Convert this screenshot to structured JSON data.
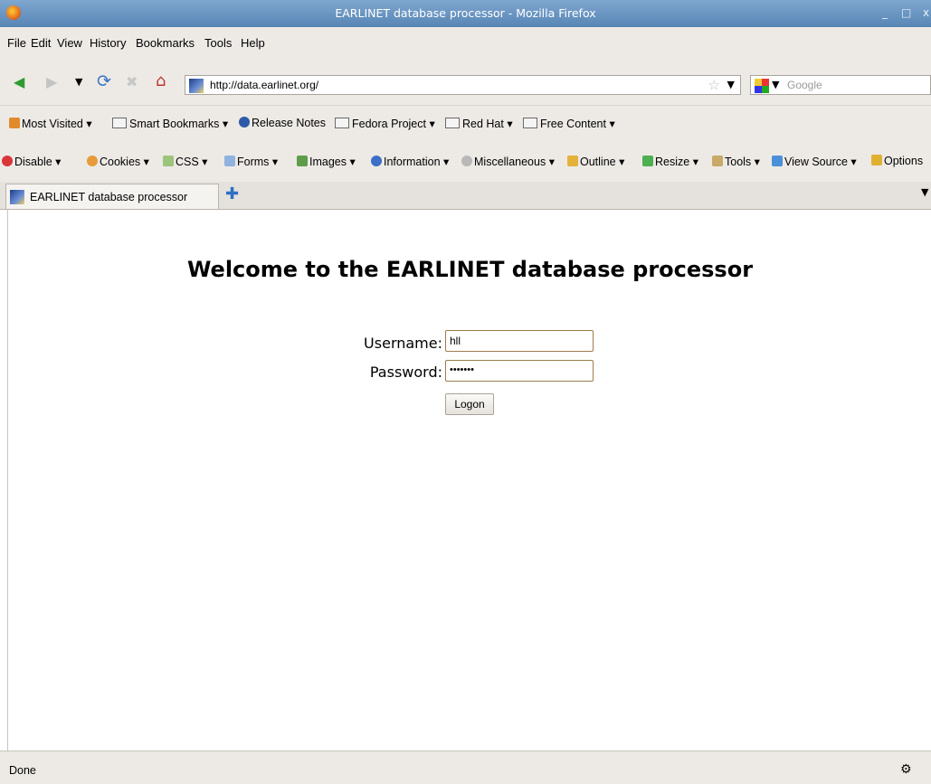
{
  "window": {
    "title": "EARLINET database processor - Mozilla Firefox",
    "minimize": "_",
    "maximize": "□",
    "close": "x"
  },
  "menu": [
    "File",
    "Edit",
    "View",
    "History",
    "Bookmarks",
    "Tools",
    "Help"
  ],
  "nav": {
    "url": "http://data.earlinet.org/",
    "search_placeholder": "Google"
  },
  "bookmarks": [
    "Most Visited",
    "Smart Bookmarks",
    "Release Notes",
    "Fedora Project",
    "Red Hat",
    "Free Content"
  ],
  "devtools": [
    "Disable",
    "Cookies",
    "CSS",
    "Forms",
    "Images",
    "Information",
    "Miscellaneous",
    "Outline",
    "Resize",
    "Tools",
    "View Source",
    "Options"
  ],
  "tab": {
    "label": "EARLINET database processor"
  },
  "page": {
    "heading": "Welcome to the EARLINET database processor",
    "username_label": "Username:",
    "username_value": "hll",
    "password_label": "Password:",
    "password_value": "•••••••",
    "logon_label": "Logon"
  },
  "status": {
    "text": "Done"
  }
}
